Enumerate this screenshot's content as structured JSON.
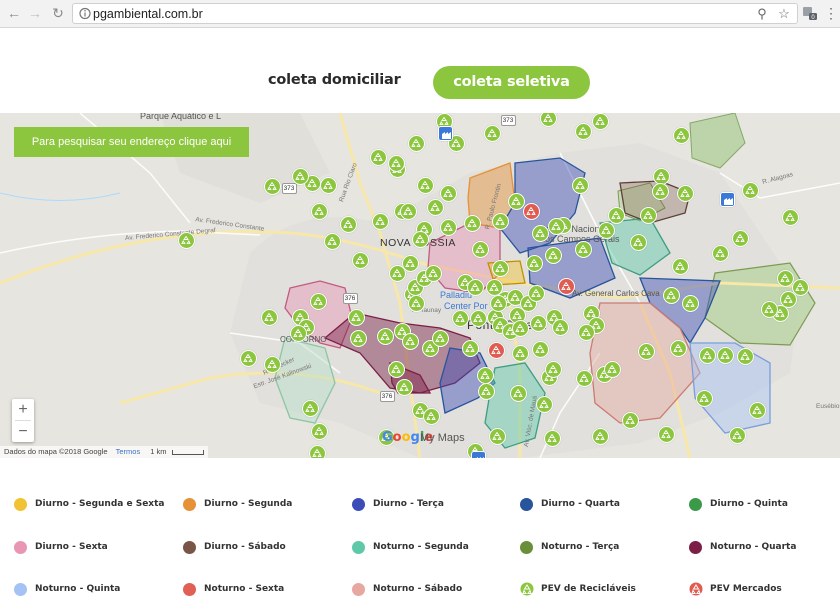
{
  "browser": {
    "url": "pgambiental.com.br",
    "extension_badge": "0"
  },
  "tabs": {
    "domiciliar": "coleta domiciliar",
    "seletiva": "coleta seletiva"
  },
  "map": {
    "search_button": "Para pesquisar seu endereço clique aqui",
    "labels": {
      "parque": "Parque Aquático e L",
      "nova_russia": "NOVA RÚSSIA",
      "contorno": "CONTORNO",
      "ponta_grossa": "Ponta Grossa",
      "palladium": "Palladiu",
      "center": "Center Por",
      "parque_nacional": "Parque Nacional",
      "campos_gerais": "dos Campos Gerais",
      "av_general": "Av. General Carlos Cava",
      "av_frederico": "Av. Frederico Constante Degraf",
      "av_frederico2": "Av. Frederico Constante",
      "estrada_jose": "Estr. José Kalinowski",
      "rua_paulo": "R. Paulo Frontin",
      "rua_rio_claro": "Rua Rio Claro",
      "av_visconde": "Av. Visc. de Mauá",
      "taunay": "R. Taunay",
      "alagoas": "R. Alagoas",
      "eusebio": "Eusébio",
      "ruabecker": "Rua Becker"
    },
    "route_shields": [
      "373",
      "373",
      "376",
      "376"
    ],
    "zoom_in": "+",
    "zoom_out": "−",
    "attribution": "Dados do mapa ©2018 Google",
    "terms": "Termos",
    "scale": "1 km",
    "google": "Google",
    "my_maps": "My Maps"
  },
  "legend": [
    {
      "label": "Diurno - Segunda e Sexta",
      "color": "#f1c232"
    },
    {
      "label": "Diurno - Segunda",
      "color": "#e69138"
    },
    {
      "label": "Diurno - Terça",
      "color": "#3d4db7"
    },
    {
      "label": "Diurno - Quarta",
      "color": "#27549b"
    },
    {
      "label": "Diurno - Quinta",
      "color": "#3b9a4a"
    },
    {
      "label": "Diurno - Sexta",
      "color": "#e995b4"
    },
    {
      "label": "Diurno - Sábado",
      "color": "#795548"
    },
    {
      "label": "Noturno - Segunda",
      "color": "#5ec8a8"
    },
    {
      "label": "Noturno - Terça",
      "color": "#6a8f3a"
    },
    {
      "label": "Noturno - Quarta",
      "color": "#7b1f46"
    },
    {
      "label": "Noturno - Quinta",
      "color": "#a4c2f4"
    },
    {
      "label": "Noturno - Sexta",
      "color": "#e06055"
    },
    {
      "label": "Noturno - Sábado",
      "color": "#e6a8a0"
    },
    {
      "label": "PEV de Recicláveis",
      "color": "#8cc63f",
      "icon": "recycle-icon"
    },
    {
      "label": "PEV Mercados",
      "color": "#e05b50",
      "icon": "recycle-icon"
    }
  ]
}
